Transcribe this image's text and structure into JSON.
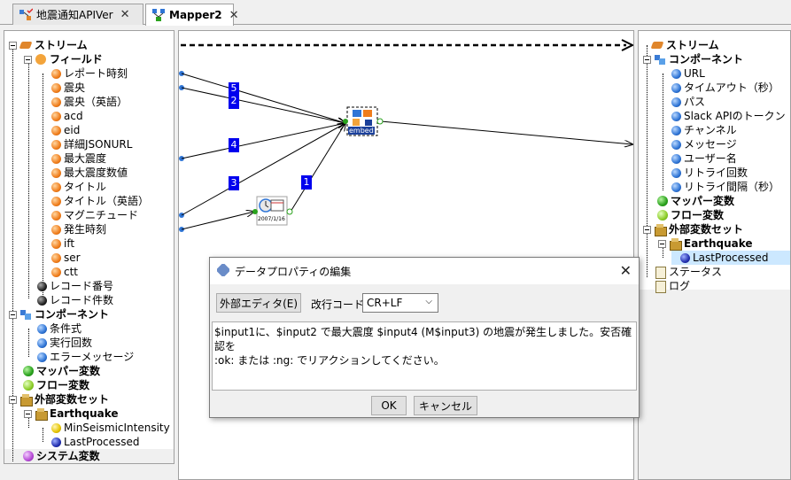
{
  "tabs": [
    {
      "label": "地震通知APIVer",
      "active": false
    },
    {
      "label": "Mapper2",
      "active": true
    }
  ],
  "left_tree": {
    "stream": "ストリーム",
    "fields": "フィールド",
    "field_items": [
      "レポート時刻",
      "震央",
      "震央（英語）",
      "acd",
      "eid",
      "詳細JSONURL",
      "最大震度",
      "最大震度数値",
      "タイトル",
      "タイトル（英語）",
      "マグニチュード",
      "発生時刻",
      "ift",
      "ser",
      "ctt"
    ],
    "record_no": "レコード番号",
    "record_count": "レコード件数",
    "component": "コンポーネント",
    "component_items": [
      "条件式",
      "実行回数",
      "エラーメッセージ"
    ],
    "mapper_vars": "マッパー変数",
    "flow_vars": "フロー変数",
    "ext_set": "外部変数セット",
    "earthquake": "Earthquake",
    "eq_items": [
      "MinSeismicIntensity",
      "LastProcessed"
    ],
    "system_vars": "システム変数"
  },
  "right_tree": {
    "stream": "ストリーム",
    "component": "コンポーネント",
    "component_items": [
      "URL",
      "タイムアウト（秒）",
      "パス",
      "Slack APIのトークン",
      "チャンネル",
      "メッセージ",
      "ユーザー名",
      "リトライ回数",
      "リトライ間隔（秒）"
    ],
    "mapper_vars": "マッパー変数",
    "flow_vars": "フロー変数",
    "ext_set": "外部変数セット",
    "earthquake": "Earthquake",
    "eq_item": "LastProcessed",
    "status": "ステータス",
    "log": "ログ"
  },
  "canvas": {
    "link_labels": [
      "5",
      "2",
      "4",
      "3",
      "1"
    ],
    "embed_label": "embed",
    "date_label": "2007/1/16"
  },
  "dialog": {
    "title": "データプロパティの編集",
    "ext_editor_button": "外部エディタ(E)",
    "newline_label": "改行コード:",
    "newline_value": "CR+LF",
    "text_line1": "$input1に、$input2 で最大震度 $input4 (M$input3) の地震が発生しました。安否確認を",
    "text_line2": ":ok: または :ng: でリアクションしてください。",
    "ok_button": "OK",
    "cancel_button": "キャンセル"
  }
}
